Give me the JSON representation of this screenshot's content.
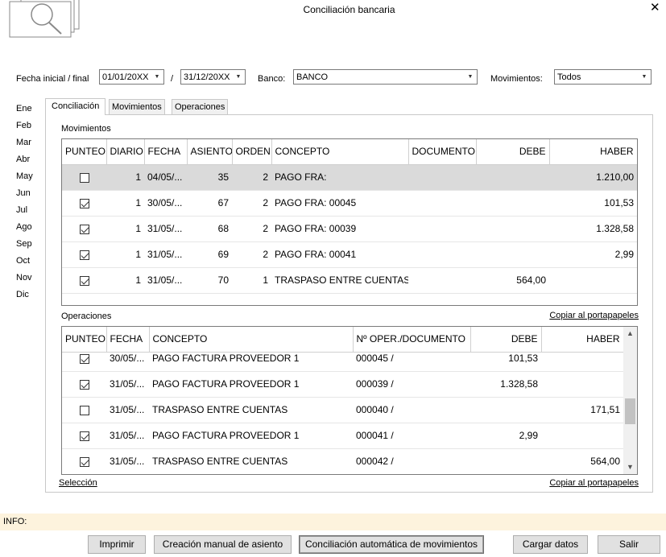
{
  "window": {
    "title": "Conciliación bancaria",
    "close_icon": "close-icon"
  },
  "filters": {
    "fecha_label": "Fecha inicial / final",
    "fecha_inicial": "01/01/20XX",
    "separator": "/",
    "fecha_final": "31/12/20XX",
    "banco_label": "Banco:",
    "banco_value": "BANCO",
    "movimientos_label": "Movimientos:",
    "movimientos_value": "Todos"
  },
  "months": [
    "Ene",
    "Feb",
    "Mar",
    "Abr",
    "May",
    "Jun",
    "Jul",
    "Ago",
    "Sep",
    "Oct",
    "Nov",
    "Dic"
  ],
  "tabs": [
    {
      "label": "Conciliación",
      "active": true
    },
    {
      "label": "Movimientos",
      "active": false
    },
    {
      "label": "Operaciones",
      "active": false
    }
  ],
  "movimientos": {
    "section_title": "Movimientos",
    "columns": [
      "PUNTEO",
      "DIARIO",
      "FECHA",
      "ASIENTO",
      "ORDEN",
      "CONCEPTO",
      "DOCUMENTO",
      "DEBE",
      "HABER"
    ],
    "rows": [
      {
        "punteo": false,
        "diario": "1",
        "fecha": "04/05/...",
        "asiento": "35",
        "orden": "2",
        "concepto": "PAGO FRA:",
        "documento": "",
        "debe": "",
        "haber": "1.210,00",
        "selected": true
      },
      {
        "punteo": true,
        "diario": "1",
        "fecha": "30/05/...",
        "asiento": "67",
        "orden": "2",
        "concepto": "PAGO FRA: 00045",
        "documento": "",
        "debe": "",
        "haber": "101,53",
        "selected": false
      },
      {
        "punteo": true,
        "diario": "1",
        "fecha": "31/05/...",
        "asiento": "68",
        "orden": "2",
        "concepto": "PAGO FRA: 00039",
        "documento": "",
        "debe": "",
        "haber": "1.328,58",
        "selected": false
      },
      {
        "punteo": true,
        "diario": "1",
        "fecha": "31/05/...",
        "asiento": "69",
        "orden": "2",
        "concepto": "PAGO FRA: 00041",
        "documento": "",
        "debe": "",
        "haber": "2,99",
        "selected": false
      },
      {
        "punteo": true,
        "diario": "1",
        "fecha": "31/05/...",
        "asiento": "70",
        "orden": "1",
        "concepto": "TRASPASO ENTRE CUENTAS",
        "documento": "",
        "debe": "564,00",
        "haber": "",
        "selected": false
      }
    ]
  },
  "operaciones": {
    "section_title": "Operaciones",
    "copy_link": "Copiar al portapapeles",
    "columns": [
      "PUNTEO",
      "FECHA",
      "CONCEPTO",
      "Nº OPER./DOCUMENTO",
      "DEBE",
      "HABER"
    ],
    "rows": [
      {
        "punteo": true,
        "fecha": "30/05/...",
        "concepto": "PAGO FACTURA PROVEEDOR 1",
        "documento": "000045 /",
        "debe": "101,53",
        "haber": ""
      },
      {
        "punteo": true,
        "fecha": "31/05/...",
        "concepto": "PAGO FACTURA PROVEEDOR 1",
        "documento": "000039 /",
        "debe": "1.328,58",
        "haber": ""
      },
      {
        "punteo": false,
        "fecha": "31/05/...",
        "concepto": "TRASPASO ENTRE CUENTAS",
        "documento": "000040 /",
        "debe": "",
        "haber": "171,51"
      },
      {
        "punteo": true,
        "fecha": "31/05/...",
        "concepto": "PAGO FACTURA PROVEEDOR 1",
        "documento": "000041 /",
        "debe": "2,99",
        "haber": ""
      },
      {
        "punteo": true,
        "fecha": "31/05/...",
        "concepto": "TRASPASO ENTRE CUENTAS",
        "documento": "000042 /",
        "debe": "",
        "haber": "564,00"
      }
    ]
  },
  "footer_links": {
    "seleccion": "Selección",
    "copy": "Copiar al portapapeles"
  },
  "info": {
    "label": "INFO:"
  },
  "buttons": {
    "imprimir": "Imprimir",
    "creacion": "Creación manual de asiento",
    "conciliacion": "Conciliación automática de movimientos",
    "cargar": "Cargar datos",
    "salir": "Salir"
  }
}
